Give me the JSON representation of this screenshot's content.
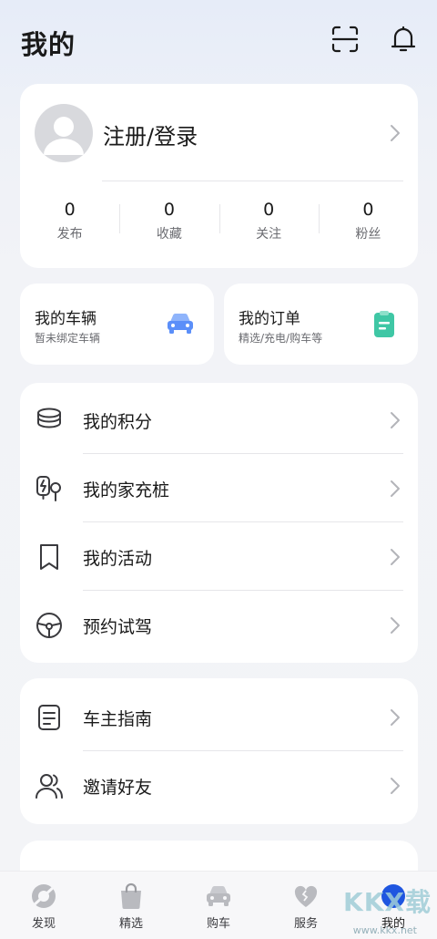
{
  "header": {
    "title": "我的",
    "scan_icon": "scan-icon",
    "bell_icon": "bell-icon"
  },
  "profile": {
    "login_label": "注册/登录",
    "stats": [
      {
        "value": "0",
        "label": "发布"
      },
      {
        "value": "0",
        "label": "收藏"
      },
      {
        "value": "0",
        "label": "关注"
      },
      {
        "value": "0",
        "label": "粉丝"
      }
    ]
  },
  "tiles": {
    "vehicle": {
      "title": "我的车辆",
      "subtitle": "暂未绑定车辆",
      "icon": "car-icon",
      "color": "#5b8ff9"
    },
    "orders": {
      "title": "我的订单",
      "subtitle": "精选/充电/购车等",
      "icon": "clipboard-icon",
      "color": "#3fc7a5"
    }
  },
  "menu_main": [
    {
      "label": "我的积分",
      "icon": "coins-icon"
    },
    {
      "label": "我的家充桩",
      "icon": "charger-icon"
    },
    {
      "label": "我的活动",
      "icon": "bookmark-icon"
    },
    {
      "label": "预约试驾",
      "icon": "steering-wheel-icon"
    }
  ],
  "menu_secondary": [
    {
      "label": "车主指南",
      "icon": "guide-icon"
    },
    {
      "label": "邀请好友",
      "icon": "invite-friends-icon"
    }
  ],
  "bottom_nav": [
    {
      "label": "发现",
      "icon": "discover-icon",
      "active": false
    },
    {
      "label": "精选",
      "icon": "shopping-bag-icon",
      "active": false
    },
    {
      "label": "购车",
      "icon": "car-icon",
      "active": false
    },
    {
      "label": "服务",
      "icon": "heart-service-icon",
      "active": false
    },
    {
      "label": "我的",
      "icon": "profile-dot-icon",
      "active": true
    }
  ],
  "colors": {
    "accent": "#1f56e0",
    "nav_inactive": "#b9babf"
  },
  "watermark": {
    "text": "KKX载",
    "url": "www.kkx.net"
  }
}
